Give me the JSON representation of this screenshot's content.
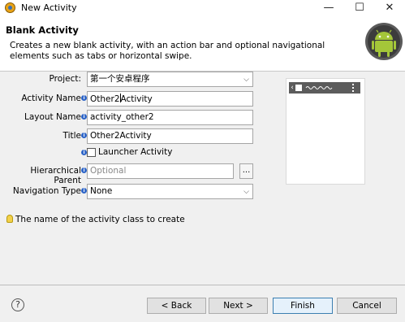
{
  "window": {
    "title": "New Activity",
    "minimize_glyph": "—",
    "maximize_glyph": "☐",
    "close_glyph": "✕"
  },
  "header": {
    "title": "Blank Activity",
    "description": "Creates a new blank activity, with an action bar and optional navigational elements such as tabs or horizontal swipe."
  },
  "form": {
    "project": {
      "label": "Project:",
      "value": "第一个安卓程序"
    },
    "activity_name": {
      "label": "Activity Name",
      "value_before_cursor": "Other2",
      "value_after_cursor": "Activity"
    },
    "layout_name": {
      "label": "Layout Name",
      "value": "activity_other2"
    },
    "title": {
      "label": "Title",
      "value": "Other2Activity"
    },
    "launcher_activity": {
      "label": "Launcher Activity",
      "checked": false
    },
    "hierarchical_parent": {
      "label": "Hierarchical Parent",
      "placeholder": "Optional",
      "browse_label": "..."
    },
    "navigation_type": {
      "label": "Navigation Type",
      "value": "None"
    }
  },
  "status_message": "The name of the activity class to create",
  "buttons": {
    "back": "< Back",
    "next": "Next >",
    "finish": "Finish",
    "cancel": "Cancel",
    "help": "?"
  },
  "colors": {
    "info_icon": "#2f66c8",
    "android_green": "#a4c639",
    "default_button_border": "#3c7fb1"
  }
}
